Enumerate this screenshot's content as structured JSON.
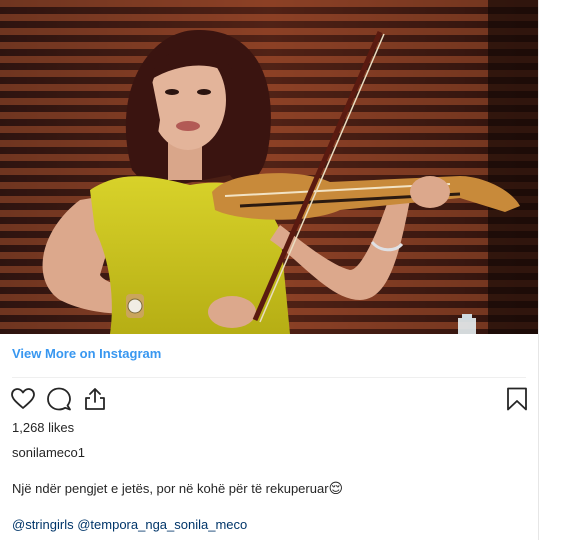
{
  "post": {
    "view_more": "View More on Instagram",
    "likes": "1,268 likes",
    "username": "sonilameco1",
    "caption": "Një ndër pengjet e jetës, por në kohë për të rekuperuar",
    "caption_emoji": "😌",
    "tags": [
      "@stringirls",
      "@tempora_nga_sonila_meco"
    ],
    "icons": {
      "like": "heart-icon",
      "comment": "comment-icon",
      "share": "share-icon",
      "save": "bookmark-icon"
    }
  },
  "colors": {
    "link": "#3897f0",
    "tag": "#003569",
    "dress": "#c8c21e",
    "background_wood": "#6b2a18"
  }
}
